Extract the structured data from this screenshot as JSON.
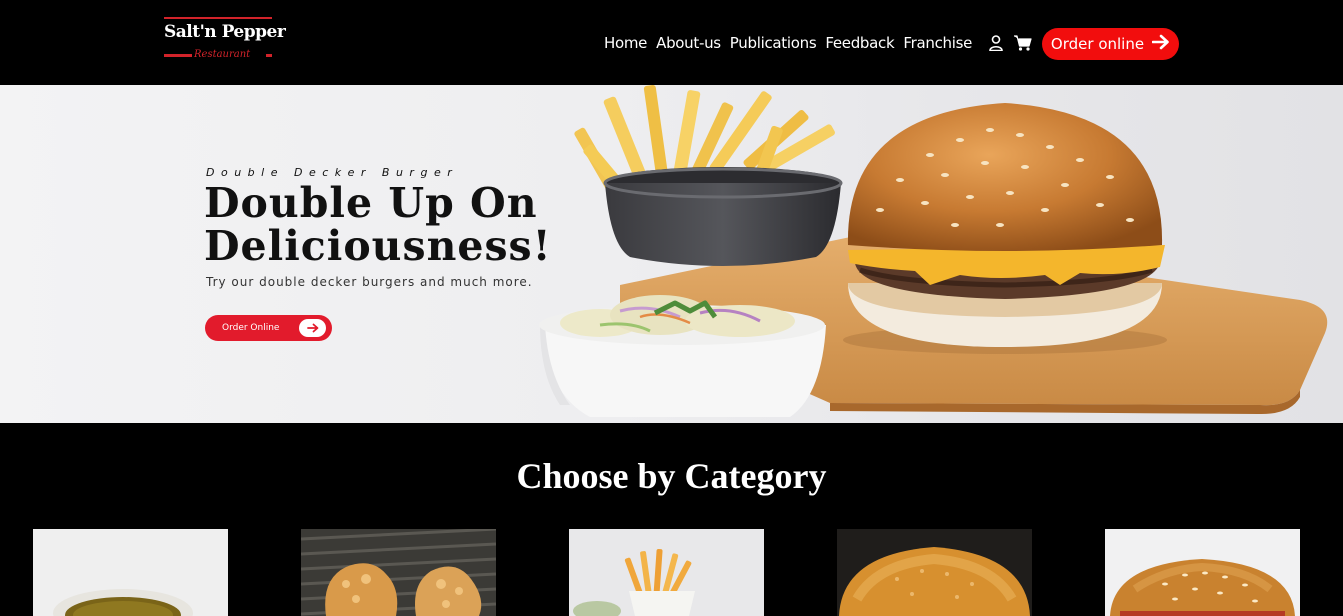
{
  "header": {
    "logo": {
      "brand": "Salt'n Pepper",
      "sub": "Restaurant"
    },
    "nav": [
      "Home",
      "About-us",
      "Publications",
      "Feedback",
      "Franchise"
    ],
    "icons": {
      "user": "user-icon",
      "cart": "cart-icon"
    },
    "order_button": "Order online"
  },
  "hero": {
    "kicker": "Double Decker Burger",
    "headline_line1": "Double Up On",
    "headline_line2": "Deliciousness!",
    "tagline": "Try our double decker burgers and much more.",
    "button": "Order Online"
  },
  "categories": {
    "title": "Choose by Category",
    "items": [
      {
        "image": "soup-bowl"
      },
      {
        "image": "fried-chicken"
      },
      {
        "image": "french-fries"
      },
      {
        "image": "bun"
      },
      {
        "image": "burger"
      }
    ]
  },
  "colors": {
    "accent": "#f20d0d",
    "hero_button": "#e21b2c",
    "logo_red": "#d2232a",
    "background": "#000000"
  }
}
